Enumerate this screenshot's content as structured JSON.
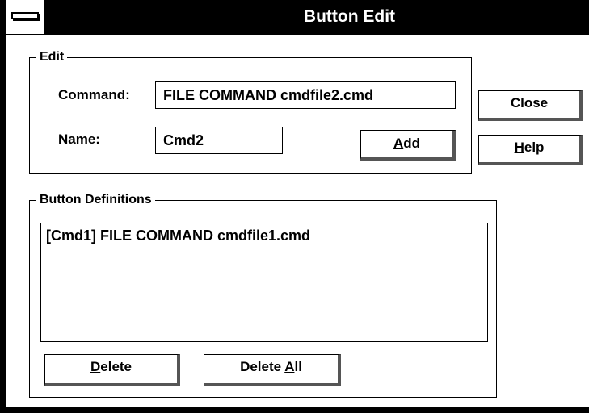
{
  "window": {
    "title": "Button Edit"
  },
  "edit_group": {
    "label": "Edit",
    "command_label": "Command:",
    "command_value": "FILE COMMAND cmdfile2.cmd",
    "name_label": "Name:",
    "name_value": "Cmd2",
    "add_pre": "",
    "add_mnemonic": "A",
    "add_post": "dd"
  },
  "side_buttons": {
    "close_label": "Close",
    "help_mnemonic": "H",
    "help_post": "elp"
  },
  "definitions_group": {
    "label": "Button Definitions",
    "items": [
      "[Cmd1] FILE COMMAND cmdfile1.cmd"
    ],
    "delete_mnemonic": "D",
    "delete_post": "elete",
    "delete_all_pre": "Delete ",
    "delete_all_mnemonic": "A",
    "delete_all_post": "ll"
  },
  "icons": {
    "system_menu": "system-menu-icon"
  }
}
